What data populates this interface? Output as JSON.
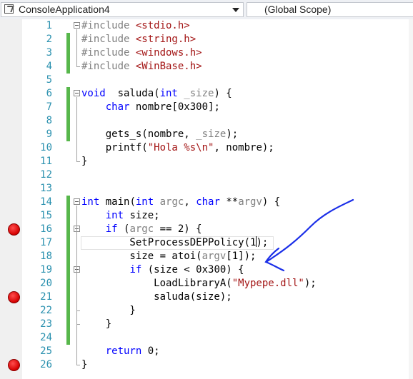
{
  "nav": {
    "project": "ConsoleApplication4",
    "scope": "(Global Scope)"
  },
  "lines": [
    {
      "n": "1",
      "tokens": [
        [
          "pp",
          "#include "
        ],
        [
          "str",
          "<stdio.h>"
        ]
      ]
    },
    {
      "n": "2",
      "tokens": [
        [
          "pp",
          "#include "
        ],
        [
          "str",
          "<string.h>"
        ]
      ]
    },
    {
      "n": "3",
      "tokens": [
        [
          "pp",
          "#include "
        ],
        [
          "str",
          "<windows.h>"
        ]
      ]
    },
    {
      "n": "4",
      "tokens": [
        [
          "pp",
          "#include "
        ],
        [
          "str",
          "<WinBase.h>"
        ]
      ]
    },
    {
      "n": "5",
      "tokens": []
    },
    {
      "n": "6",
      "tokens": [
        [
          "kw",
          "void"
        ],
        [
          "",
          "  saluda("
        ],
        [
          "kw",
          "int"
        ],
        [
          "",
          ""
        ],
        [
          "param",
          " _size"
        ],
        [
          "",
          ") {"
        ]
      ]
    },
    {
      "n": "7",
      "tokens": [
        [
          "",
          "    "
        ],
        [
          "kw",
          "char"
        ],
        [
          "",
          " nombre[0x300];"
        ]
      ]
    },
    {
      "n": "8",
      "tokens": []
    },
    {
      "n": "9",
      "tokens": [
        [
          "",
          "    gets_s(nombre, "
        ],
        [
          "param",
          "_size"
        ],
        [
          "",
          ");"
        ]
      ]
    },
    {
      "n": "10",
      "tokens": [
        [
          "",
          "    printf("
        ],
        [
          "str",
          "\"Hola %s\\n\""
        ],
        [
          "",
          ", nombre);"
        ]
      ]
    },
    {
      "n": "11",
      "tokens": [
        [
          "",
          "}"
        ]
      ]
    },
    {
      "n": "12",
      "tokens": []
    },
    {
      "n": "13",
      "tokens": []
    },
    {
      "n": "14",
      "tokens": [
        [
          "kw",
          "int"
        ],
        [
          "",
          " main("
        ],
        [
          "kw",
          "int"
        ],
        [
          "param",
          " argc"
        ],
        [
          "",
          ", "
        ],
        [
          "kw",
          "char"
        ],
        [
          "",
          " **"
        ],
        [
          "param",
          "argv"
        ],
        [
          "",
          ") {"
        ]
      ]
    },
    {
      "n": "15",
      "tokens": [
        [
          "",
          "    "
        ],
        [
          "kw",
          "int"
        ],
        [
          "",
          " size;"
        ]
      ]
    },
    {
      "n": "16",
      "tokens": [
        [
          "",
          "    "
        ],
        [
          "kw",
          "if"
        ],
        [
          "",
          " ("
        ],
        [
          "param",
          "argc"
        ],
        [
          "",
          " == 2) {"
        ]
      ]
    },
    {
      "n": "17",
      "tokens": [
        [
          "",
          "        SetProcessDEPPolicy(1"
        ],
        [
          "caret",
          ""
        ],
        [
          "",
          ");"
        ]
      ]
    },
    {
      "n": "18",
      "tokens": [
        [
          "",
          "        size = atoi("
        ],
        [
          "param",
          "argv"
        ],
        [
          "",
          "[1]);"
        ]
      ]
    },
    {
      "n": "19",
      "tokens": [
        [
          "",
          "        "
        ],
        [
          "kw",
          "if"
        ],
        [
          "",
          " (size < 0x300) {"
        ]
      ]
    },
    {
      "n": "20",
      "tokens": [
        [
          "",
          "            LoadLibraryA("
        ],
        [
          "str",
          "\"Mypepe.dll\""
        ],
        [
          "",
          ");"
        ]
      ]
    },
    {
      "n": "21",
      "tokens": [
        [
          "",
          "            saluda(size);"
        ]
      ]
    },
    {
      "n": "22",
      "tokens": [
        [
          "",
          "        }"
        ]
      ]
    },
    {
      "n": "23",
      "tokens": [
        [
          "",
          "    }"
        ]
      ]
    },
    {
      "n": "24",
      "tokens": []
    },
    {
      "n": "25",
      "tokens": [
        [
          "",
          "    "
        ],
        [
          "kw",
          "return"
        ],
        [
          "",
          " 0;"
        ]
      ]
    },
    {
      "n": "26",
      "tokens": [
        [
          "",
          "}"
        ]
      ]
    }
  ],
  "breakpoints": [
    "16",
    "21",
    "26"
  ],
  "changed_lines": [
    "2",
    "3",
    "4",
    "6",
    "7",
    "8",
    "9",
    "14",
    "15",
    "16",
    "17",
    "18",
    "19",
    "20",
    "21",
    "22",
    "23",
    "24"
  ],
  "fold_lines": [
    "1",
    "6",
    "14",
    "16",
    "19"
  ],
  "current_line": "17",
  "colors": {
    "keyword": "#0000ff",
    "string": "#a31515",
    "line_number": "#2b91af",
    "breakpoint": "#e51400",
    "change_bar": "#57b74b",
    "annotation": "#1a2ee8"
  }
}
